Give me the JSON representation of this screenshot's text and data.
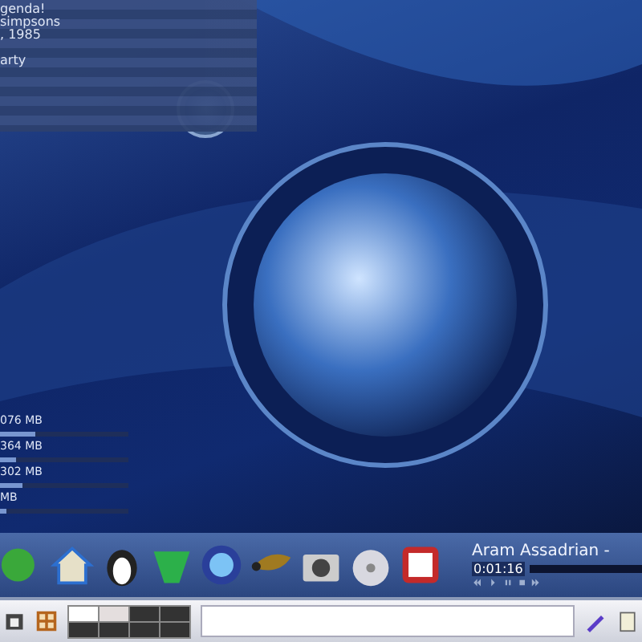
{
  "agenda": {
    "lines": [
      "genda!",
      "simpsons",
      ", 1985",
      "arty"
    ]
  },
  "memory": [
    {
      "reading": "076 MB",
      "level": 0.28
    },
    {
      "reading": "364 MB",
      "level": 0.12
    },
    {
      "reading": "302 MB",
      "level": 0.17
    },
    {
      "reading": "MB",
      "level": 0.05
    }
  ],
  "player": {
    "title": "Aram Assadrian -",
    "time": "0:01:16"
  }
}
